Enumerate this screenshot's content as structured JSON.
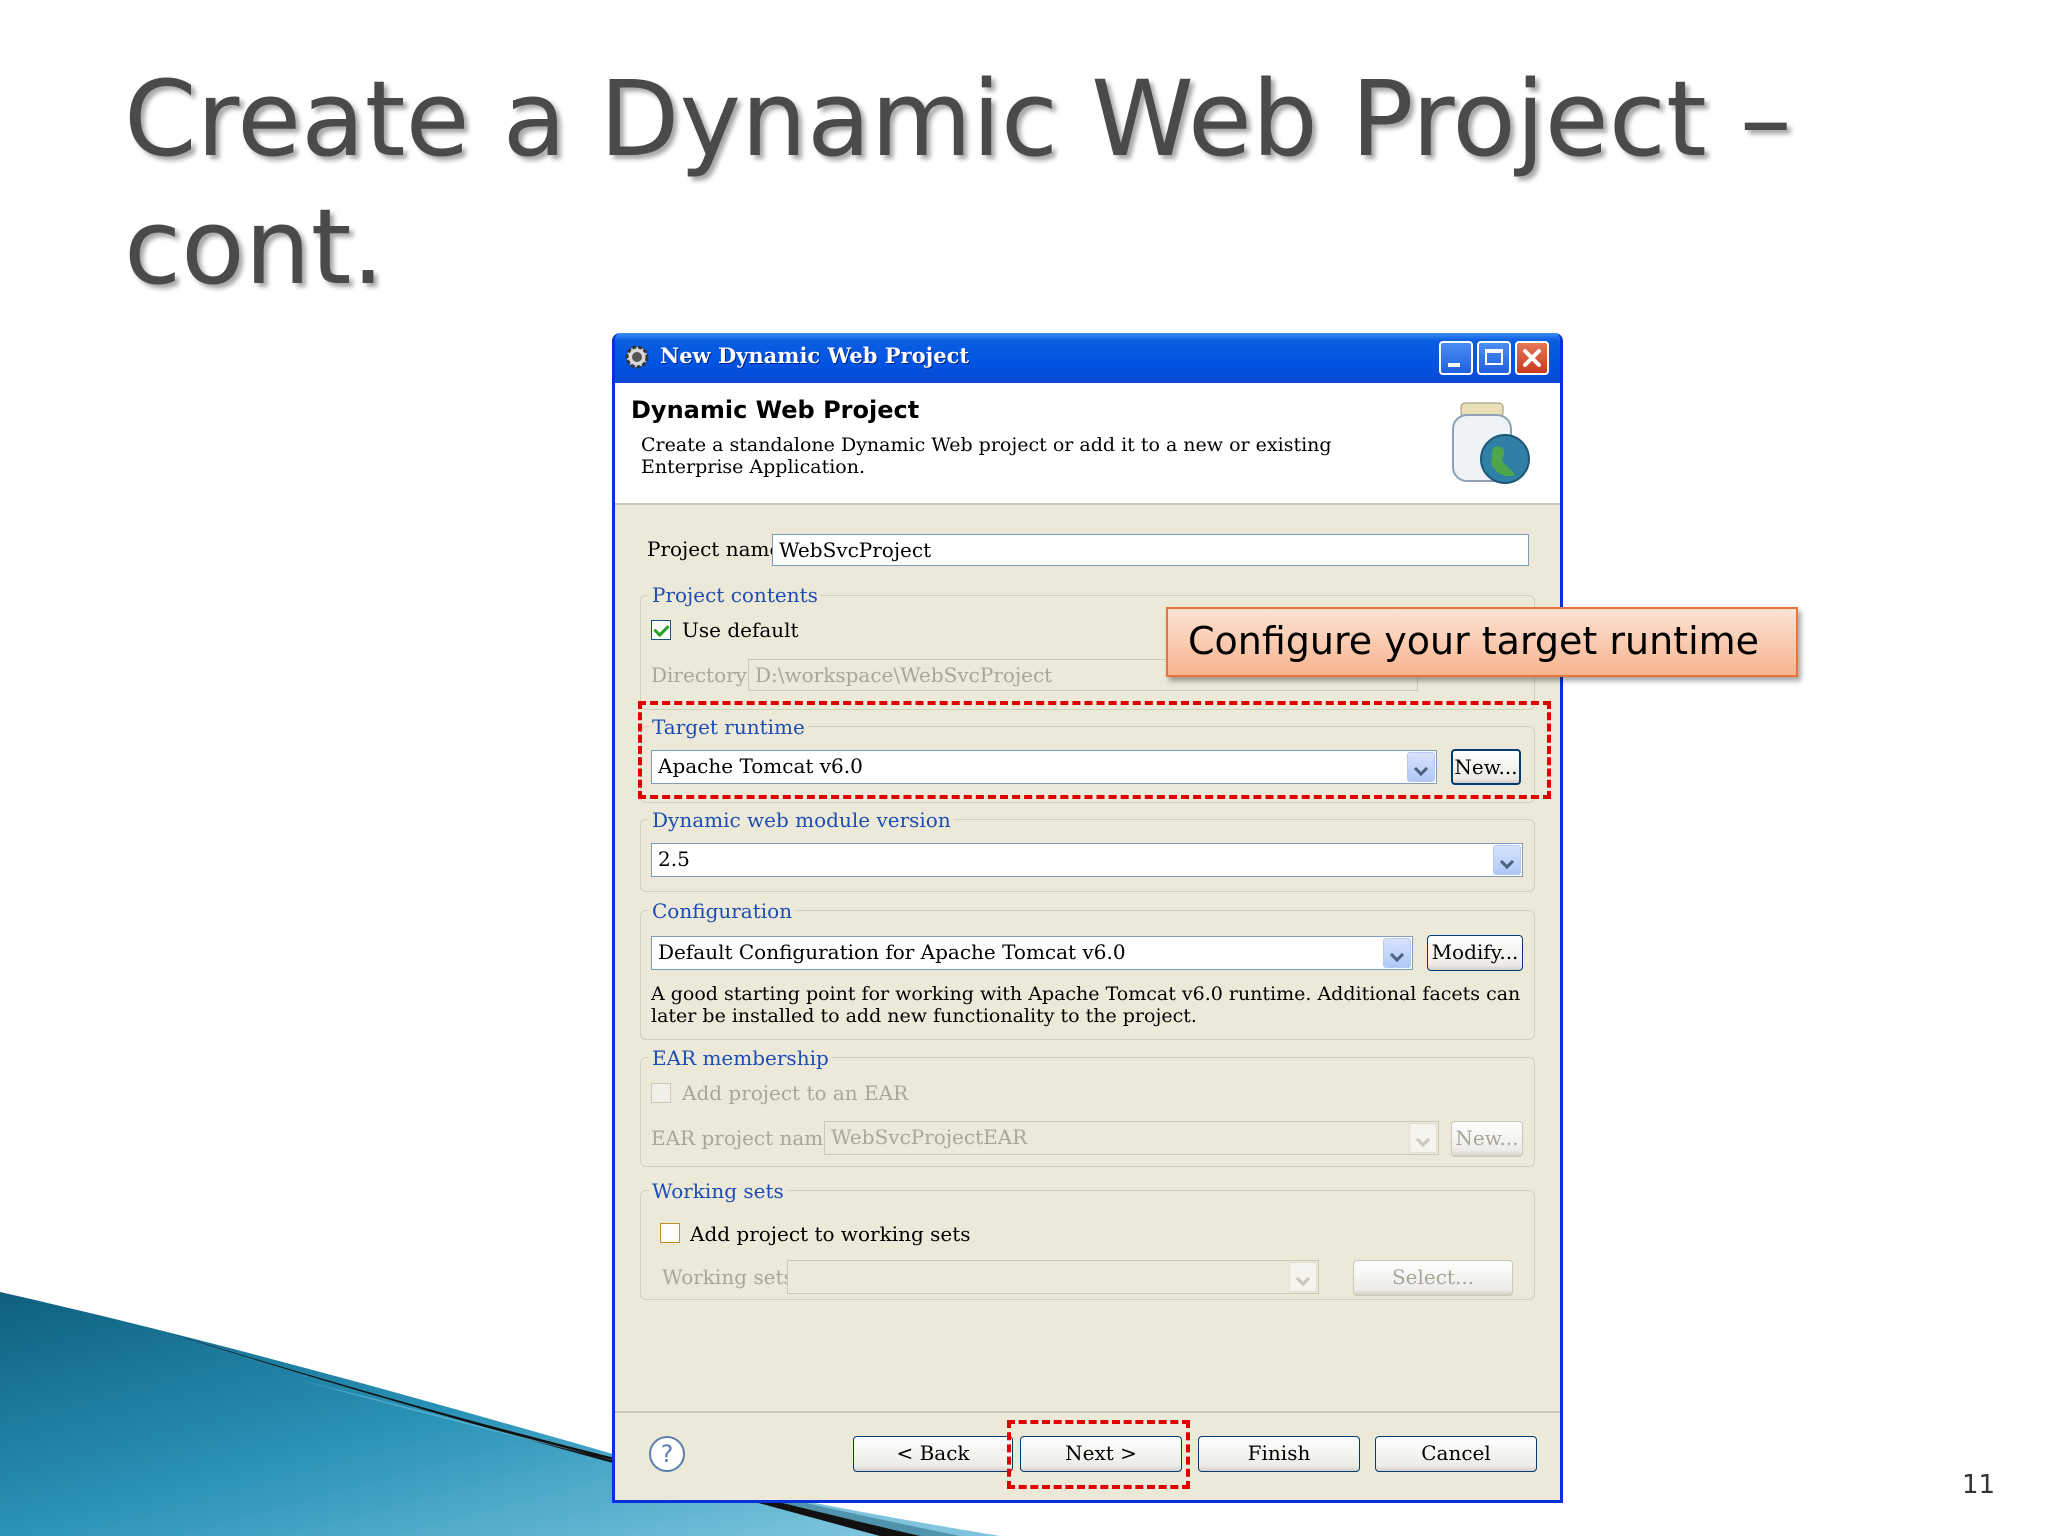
{
  "slide": {
    "title": "Create a Dynamic Web Project – cont.",
    "page_number": "11",
    "callout": "Configure your target runtime"
  },
  "dialog": {
    "window_title": "New Dynamic Web Project",
    "header_title": "Dynamic Web Project",
    "header_description": "Create a standalone Dynamic Web project or add it to a new or existing Enterprise Application.",
    "project_name_label": "Project name:",
    "project_name_value": "WebSvcProject",
    "project_contents": {
      "label": "Project contents",
      "use_default_label": "Use default",
      "use_default_checked": true,
      "directory_label": "Directory:",
      "directory_value": "D:\\workspace\\WebSvcProject"
    },
    "target_runtime": {
      "label": "Target runtime",
      "value": "Apache Tomcat v6.0",
      "new_button": "New..."
    },
    "module_version": {
      "label": "Dynamic web module version",
      "value": "2.5"
    },
    "configuration": {
      "label": "Configuration",
      "value": "Default Configuration for Apache Tomcat v6.0",
      "modify_button": "Modify...",
      "description": "A good starting point for working with Apache Tomcat v6.0 runtime. Additional facets can later be installed to add new functionality to the project."
    },
    "ear_membership": {
      "label": "EAR membership",
      "add_label": "Add project to an EAR",
      "add_checked": false,
      "project_name_label": "EAR project name:",
      "project_name_value": "WebSvcProjectEAR",
      "new_button": "New..."
    },
    "working_sets": {
      "label": "Working sets",
      "add_label": "Add project to working sets",
      "add_checked": false,
      "sets_label": "Working sets:",
      "sets_value": "",
      "select_button": "Select..."
    },
    "footer": {
      "back": "< Back",
      "next": "Next >",
      "finish": "Finish",
      "cancel": "Cancel",
      "help": "?"
    }
  },
  "colors": {
    "highlight": "#e00000",
    "callout_fill": "#f8b48e",
    "titlebar": "#0054e3",
    "group_label": "#1c4cb5"
  }
}
